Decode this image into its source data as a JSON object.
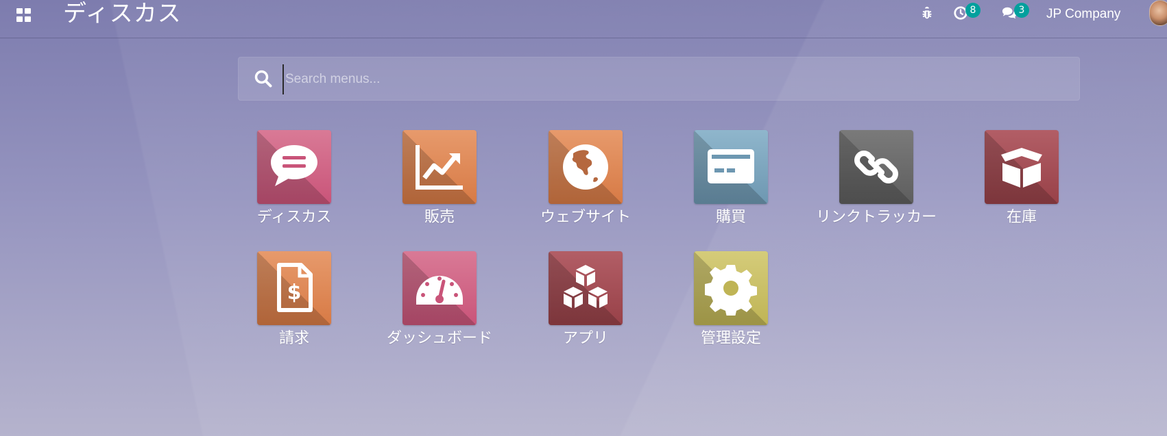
{
  "topbar": {
    "app_title": "ディスカス",
    "activity_count": "8",
    "messages_count": "3",
    "company": "JP Company"
  },
  "search": {
    "placeholder": "Search menus..."
  },
  "apps": [
    {
      "label": "ディスカス",
      "icon": "chat-bubble-icon",
      "color": "#d7678a"
    },
    {
      "label": "販売",
      "icon": "sales-chart-icon",
      "color": "#e0895a"
    },
    {
      "label": "ウェブサイト",
      "icon": "globe-icon",
      "color": "#e0895a"
    },
    {
      "label": "購買",
      "icon": "credit-card-icon",
      "color": "#82a9c0"
    },
    {
      "label": "リンクトラッカー",
      "icon": "link-icon",
      "color": "#6b6b6b"
    },
    {
      "label": "在庫",
      "icon": "box-icon",
      "color": "#a44e55"
    },
    {
      "label": "請求",
      "icon": "invoice-icon",
      "color": "#e0895a"
    },
    {
      "label": "ダッシュボード",
      "icon": "gauge-icon",
      "color": "#d7678a"
    },
    {
      "label": "アプリ",
      "icon": "cubes-icon",
      "color": "#a44e55"
    },
    {
      "label": "管理設定",
      "icon": "gear-icon",
      "color": "#c9bf66"
    }
  ]
}
